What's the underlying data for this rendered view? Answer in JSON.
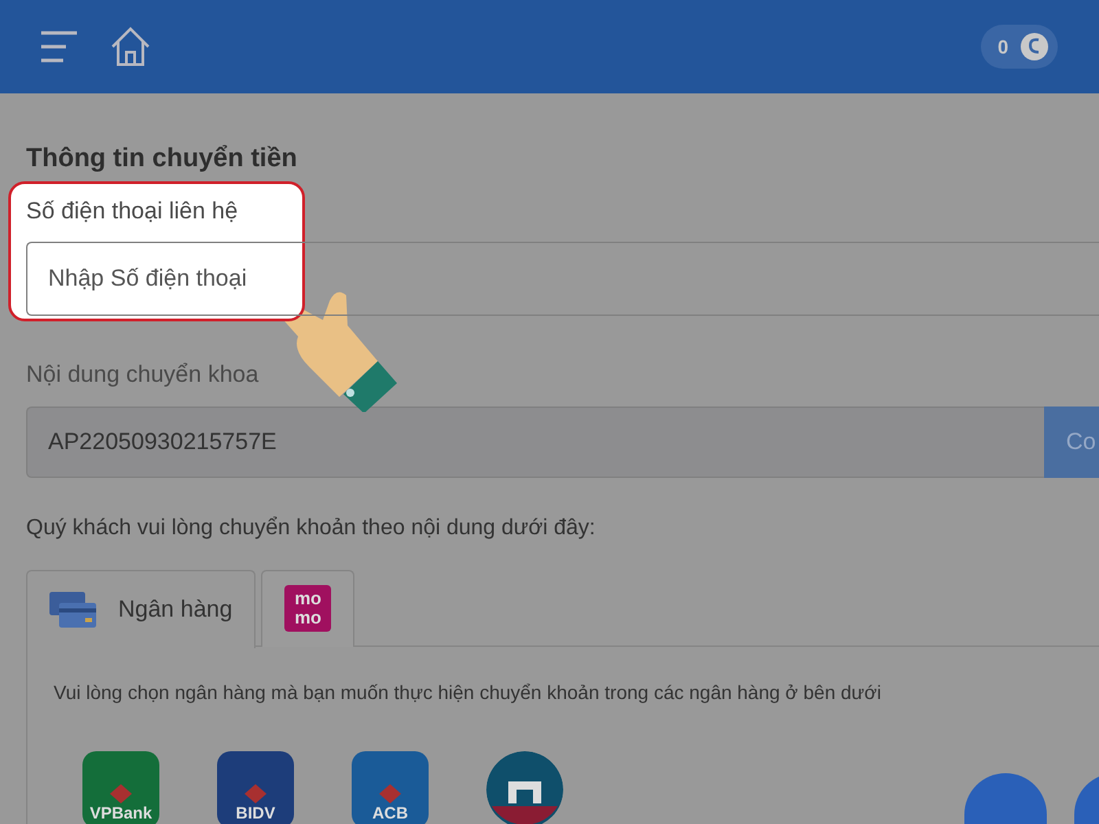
{
  "header": {
    "coin_count": "0"
  },
  "title": "Thông tin chuyển tiền",
  "phone": {
    "label": "Số điện thoại liên hệ",
    "placeholder": "Nhập Số điện thoại",
    "highlighted": true
  },
  "transfer_content": {
    "label": "Nội dung chuyển khoa",
    "value": "AP22050930215757E",
    "button": "Co"
  },
  "instruction": "Quý khách vui lòng chuyển khoản theo nội dung dưới đây:",
  "tabs": [
    {
      "kind": "card",
      "label": "Ngân hàng",
      "selected": true
    },
    {
      "kind": "logo",
      "logo_lines": [
        "mo",
        "mo"
      ],
      "selected": false
    }
  ],
  "panel_text": "Vui lòng chọn ngân hàng mà bạn muốn thực hiện chuyển khoản trong các ngân hàng ở bên dưới",
  "banks": [
    {
      "kind": "square",
      "name": "VPBank",
      "color": "#146e3a"
    },
    {
      "kind": "square",
      "name": "BIDV",
      "color": "#1d3d7a"
    },
    {
      "kind": "square",
      "name": "ACB",
      "color": "#1a5b98"
    },
    {
      "kind": "circle",
      "color": "#0f4f6b"
    }
  ]
}
